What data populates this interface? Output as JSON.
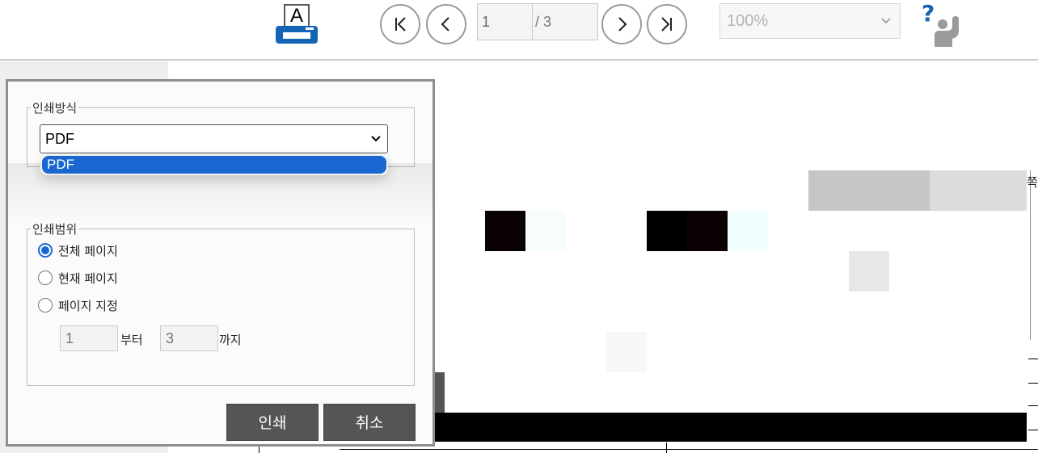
{
  "toolbar": {
    "print_icon_letter": "A",
    "page_current": "1",
    "page_total": "/ 3",
    "zoom": "100%",
    "help_icon_symbol": "?"
  },
  "document": {
    "partial_text_right": "쪽)"
  },
  "print_dialog": {
    "method_legend": "인쇄방식",
    "method_selected": "PDF",
    "method_options": [
      "PDF"
    ],
    "range_legend": "인쇄범위",
    "range_options": [
      {
        "label": "전체 페이지",
        "checked": true
      },
      {
        "label": "현재 페이지",
        "checked": false
      },
      {
        "label": "페이지 지정",
        "checked": false
      }
    ],
    "from_value": "1",
    "from_label": "부터",
    "to_value": "3",
    "to_label": "까지",
    "print_button": "인쇄",
    "cancel_button": "취소"
  },
  "colors": {
    "accent": "#1a67d2",
    "button": "#555555",
    "nav_icon": "#1565b7"
  }
}
